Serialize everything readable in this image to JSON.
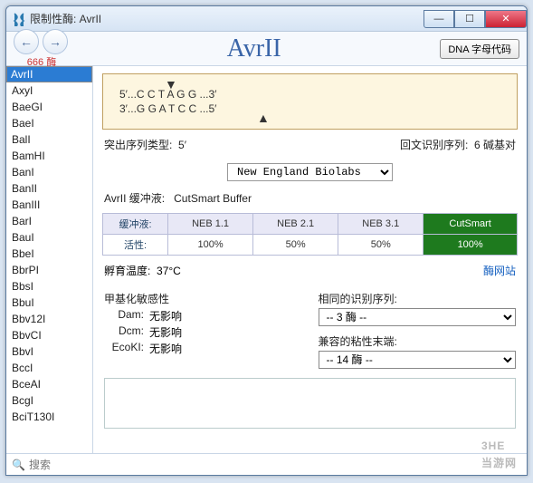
{
  "window": {
    "title": "限制性酶: AvrII"
  },
  "toolbar": {
    "back_nav_label": "666 酶",
    "enzyme_name": "AvrII",
    "dna_button": "DNA 字母代码"
  },
  "sidebar": {
    "items": [
      "AvrII",
      "AxyI",
      "BaeGI",
      "BaeI",
      "BalI",
      "BamHI",
      "BanI",
      "BanII",
      "BanIII",
      "BarI",
      "BauI",
      "BbeI",
      "BbrPI",
      "BbsI",
      "BbuI",
      "Bbv12I",
      "BbvCI",
      "BbvI",
      "BccI",
      "BceAI",
      "BcgI",
      "BciT130I"
    ],
    "selected": "AvrII",
    "search_placeholder": "搜索"
  },
  "sequence": {
    "line1": "5′...C C T A G G ...3′",
    "line2": "3′...G G A T C C ...5′"
  },
  "info": {
    "overhang_label": "突出序列类型:",
    "overhang_value": "5′",
    "palindrome_label": "回文识别序列:",
    "palindrome_value": "6 碱基对"
  },
  "supplier": {
    "selected": "New England Biolabs"
  },
  "buffer": {
    "label_prefix": "AvrII 缓冲液:",
    "value": "CutSmart Buffer",
    "table": {
      "row_labels": [
        "缓冲液:",
        "活性:"
      ],
      "headers": [
        "NEB 1.1",
        "NEB 2.1",
        "NEB 3.1",
        "CutSmart"
      ],
      "activity": [
        "100%",
        "50%",
        "50%",
        "100%"
      ]
    }
  },
  "incubation": {
    "label": "孵育温度:",
    "value": "37°C",
    "link": "酶网站"
  },
  "methyl": {
    "title": "甲基化敏感性",
    "rows": [
      {
        "k": "Dam:",
        "v": "无影响"
      },
      {
        "k": "Dcm:",
        "v": "无影响"
      },
      {
        "k": "EcoKI:",
        "v": "无影响"
      }
    ]
  },
  "same_site": {
    "label": "相同的识别序列:",
    "value": "-- 3 酶 --"
  },
  "compat_ends": {
    "label": "兼容的粘性末端:",
    "value": "-- 14 酶 --"
  },
  "watermark": {
    "big": "3HE",
    "small": "当游网"
  }
}
